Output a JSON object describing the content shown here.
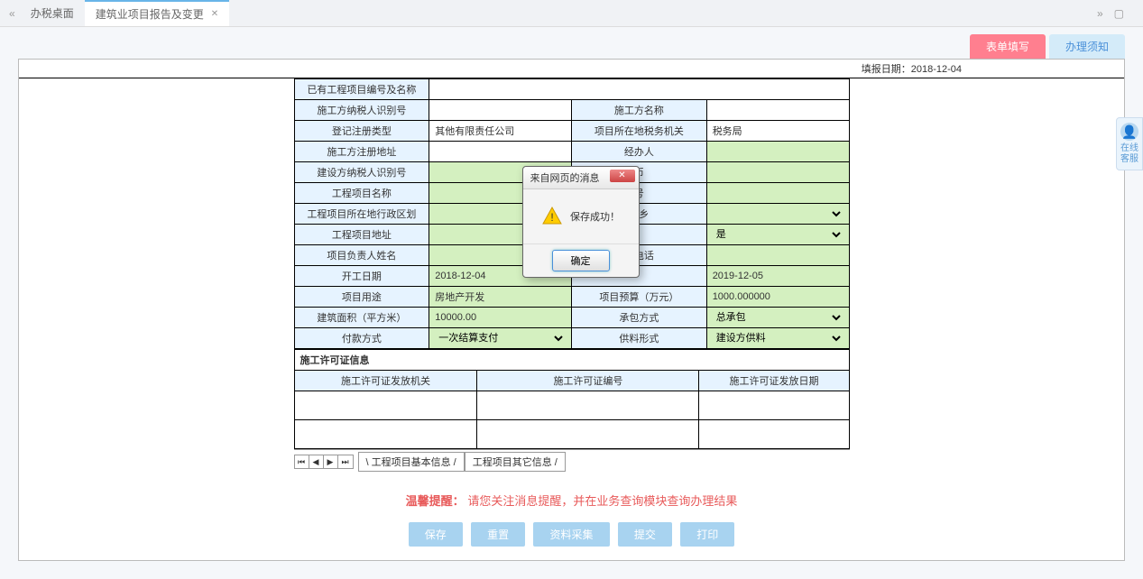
{
  "tabs": {
    "desktop": "办税桌面",
    "active": "建筑业项目报告及变更"
  },
  "subTabs": {
    "fill": "表单填写",
    "notice": "办理须知"
  },
  "reportDate": {
    "label": "填报日期：",
    "value": "2018-12-04"
  },
  "form": {
    "rows": [
      {
        "l1": "已有工程项目编号及名称",
        "v1": "",
        "span": true
      },
      {
        "l1": "施工方纳税人识别号",
        "v1": "",
        "l2": "施工方名称",
        "v2": ""
      },
      {
        "l1": "登记注册类型",
        "v1": "其他有限责任公司",
        "l2": "项目所在地税务机关",
        "v2": "税务局"
      },
      {
        "l1": "施工方注册地址",
        "v1": "",
        "l2": "经办人",
        "v2": "",
        "green2": true
      },
      {
        "l1": "建设方纳税人识别号",
        "v1": "",
        "green1": true,
        "l2": "币",
        "v2": "",
        "green2": true
      },
      {
        "l1": "工程项目名称",
        "v1": "",
        "green1": true,
        "l2": "号",
        "v2": "",
        "green2": true
      },
      {
        "l1": "工程项目所在地行政区划",
        "v1": "",
        "green1": true,
        "l2": "旨乡",
        "v2": "",
        "green2": true,
        "select2": true
      },
      {
        "l1": "工程项目地址",
        "v1": "",
        "green1": true,
        "l2": "是",
        "v2": "是",
        "green2": true,
        "select2": true,
        "l2hidden": true
      },
      {
        "l1": "项目负责人姓名",
        "v1": "",
        "green1": true,
        "l2": "系电话",
        "v2": "",
        "green2": true
      },
      {
        "l1": "开工日期",
        "v1": "2018-12-04",
        "green1": true,
        "l2": "",
        "v2": "2019-12-05",
        "green2": true,
        "l2hidden": true
      },
      {
        "l1": "项目用途",
        "v1": "房地产开发",
        "green1": true,
        "l2": "项目预算（万元）",
        "v2": "1000.000000",
        "green2": true
      },
      {
        "l1": "建筑面积（平方米）",
        "v1": "10000.00",
        "green1": true,
        "l2": "承包方式",
        "v2": "总承包",
        "green2": true,
        "select2": true
      },
      {
        "l1": "付款方式",
        "v1": "一次结算支付",
        "green1": true,
        "select1": true,
        "l2": "供料形式",
        "v2": "建设方供料",
        "green2": true,
        "select2": true
      }
    ],
    "permitHeader": "施工许可证信息",
    "permitCols": [
      "施工许可证发放机关",
      "施工许可证编号",
      "施工许可证发放日期"
    ]
  },
  "sheets": {
    "main": "工程项目基本信息",
    "other": "工程项目其它信息"
  },
  "reminder": {
    "label": "温馨提醒：",
    "text": "请您关注消息提醒，并在业务查询模块查询办理结果"
  },
  "buttons": [
    "保存",
    "重置",
    "资料采集",
    "提交",
    "打印"
  ],
  "sideWidget": "在线客服",
  "modal": {
    "title": "来自网页的消息",
    "message": "保存成功！",
    "ok": "确定"
  }
}
